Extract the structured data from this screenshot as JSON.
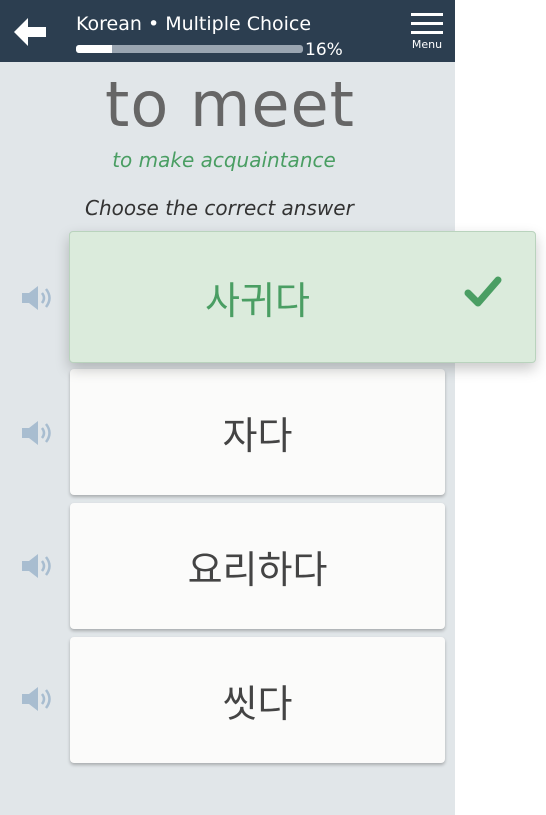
{
  "header": {
    "course_title": "Korean • Multiple Choice",
    "progress_label": "16%",
    "progress_fraction": 0.16,
    "menu_label": "Menu",
    "back_icon": "left-arrow-icon",
    "menu_icon": "hamburger-icon"
  },
  "prompt": {
    "word": "to meet",
    "definition": "to make acquaintance",
    "instruction": "Choose the correct answer"
  },
  "answers": [
    {
      "text": "사귀다",
      "state": "correct",
      "icon": "speaker-icon"
    },
    {
      "text": "자다",
      "state": "default",
      "icon": "speaker-icon"
    },
    {
      "text": "요리하다",
      "state": "default",
      "icon": "speaker-icon"
    },
    {
      "text": "씻다",
      "state": "default",
      "icon": "speaker-icon"
    }
  ],
  "colors": {
    "header_bg": "#2c3e50",
    "correct_green": "#4a9e63",
    "correct_bg": "#dbebdc",
    "speaker_blue": "#a8bdd0"
  }
}
